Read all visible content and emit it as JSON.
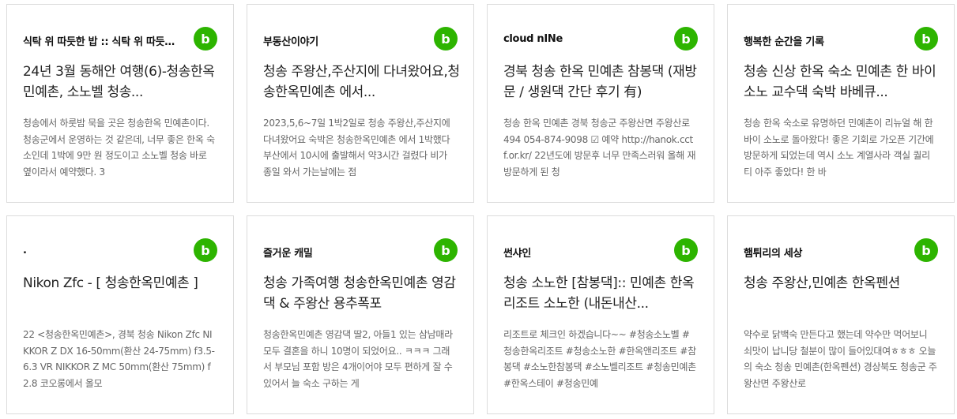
{
  "brand_color": "#2db400",
  "badge_icon": "b-logo-icon",
  "cards": [
    {
      "blog": "식탁 위 따듯한 밥 :: 식탁 위 따듯…",
      "badge": "b",
      "title": "24년 3월 동해안 여행(6)-청송한옥 민예촌, 소노벨 청송...",
      "excerpt": "청송에서 하룻밤 묵을 곳은 청송한옥 민예촌이다. 청송군에서 운영하는 것 같은데, 너무 좋은 한옥 숙소인데 1박에 9만 원 정도이고 소노벨 청송 바로 옆이라서 예약했다. 3"
    },
    {
      "blog": "부동산이야기",
      "badge": "b",
      "title": "청송 주왕산,주산지에 다녀왔어요,청송한옥민예촌 에서...",
      "excerpt": "2023,5,6~7일 1박2일로 청송 주왕산,주산지에 다녀왔어요 숙박은 청송한옥민예촌 에서 1박했다 부산에서 10시에 출발해서 약3시간 걸렸다 비가 종일 와서 가는날에는 점"
    },
    {
      "blog": "cloud nINe",
      "badge": "b",
      "title": "경북 청송 한옥 민예촌 참봉댁 (재방문 / 생원댁 간단 후기 有)",
      "excerpt": "청송 한옥 민예촌 경북 청송군 주왕산면 주왕산로 494 054-874-9098 ☑ 예약 http://hanok.cctf.or.kr/ 22년도에 방문후 너무 만족스러워 올해 재방문하게 된 청"
    },
    {
      "blog": "행복한 순간을 기록",
      "badge": "b",
      "title": "청송 신상 한옥 숙소 민예촌 한 바이 소노 교수댁 숙박 바베큐...",
      "excerpt": "청송 한옥 숙소로 유명하던 민예촌이 리뉴얼 해 한 바이 소노로 돌아왔다! 좋은 기회로 가오픈 기간에 방문하게 되었는데 역시 소노 계열사라 객실 퀄리티 아주 좋았다! 한 바"
    },
    {
      "blog": ".",
      "badge": "b",
      "title": "Nikon Zfc - [ 청송한옥민예촌 ]",
      "excerpt": "22 <청송한옥민예촌>, 경북 청송 Nikon Zfc NIKKOR Z DX 16-50mm(환산 24-75mm) f3.5-6.3 VR NIKKOR Z MC 50mm(환산 75mm) f2.8 코오롱에서 올모"
    },
    {
      "blog": "즐거운 캐밀",
      "badge": "b",
      "title": "청송 가족여행 청송한옥민예촌 영감댁 & 주왕산 용추폭포",
      "excerpt": "청송한옥민예촌 영감댁 딸2, 아들1 있는 삼남매라 모두 결혼을 하니 10명이 되었어요.. ㅋㅋㅋ 그래서 부모님 포함 방은 4개이어야 모두 편하게 잘 수 있어서 늘 숙소 구하는 게"
    },
    {
      "blog": "썬샤인",
      "badge": "b",
      "title": "청송 소노한 [참봉댁]:: 민예촌 한옥리조트 소노한 (내돈내산...",
      "excerpt": "리조트로 체크인 하겠습니다~~ #청송소노벨 #청송한옥리조트 #청송소노한 #한옥앤리조트 #참봉댁 #소노한참봉댁 #소노벨리조트 #청송민예촌 #한옥스테이 #청송민예"
    },
    {
      "blog": "햄튀리의 세상",
      "badge": "b",
      "title": "청송 주왕산,민예촌 한옥펜션",
      "excerpt": "약수로 닭백숙 만든다고 했는데 약수만 먹어보니 쇠맛이 납니당 철분이 많이 들어있대여ㅎㅎㅎ 오늘의 숙소 청송 민예촌(한옥펜션) 경상북도 청송군 주왕산면 주왕산로"
    }
  ]
}
